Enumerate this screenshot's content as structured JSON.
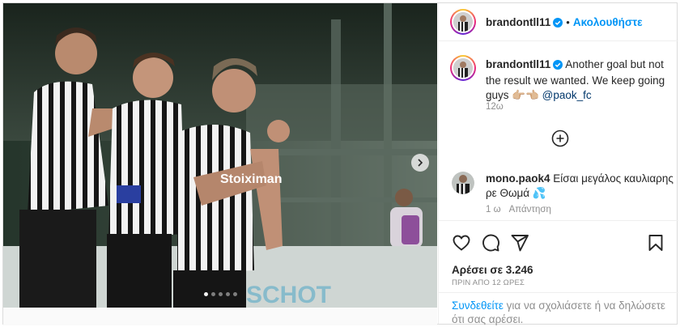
{
  "post": {
    "username": "brandontll11",
    "follow_label": "Ακολουθήστε",
    "separator": "•",
    "caption_text": "Another goal but not the result we wanted. We keep going guys 👉🏼👈🏼 ",
    "caption_mention": "@paok_fc",
    "time": "12ω",
    "likes": "Αρέσει σε 3.246",
    "posted_ago": "ΠΡΙΝ ΑΠΟ 12 ΩΡΕΣ",
    "carousel_dots": 5,
    "carousel_active": 1
  },
  "comment": {
    "username": "mono.paok4",
    "text": "Είσαι μεγάλος καυλιαρης ρε Θωμά 💦",
    "time": "1 ω",
    "reply_label": "Απάντηση"
  },
  "footer": {
    "login_link": "Συνδεθείτε",
    "login_rest": " για να σχολιάσετε ή να δηλώσετε ότι σας αρέσει."
  },
  "icons": {
    "verified": "verified-badge-icon",
    "like": "heart-icon",
    "comment": "comment-bubble-icon",
    "share": "paper-plane-icon",
    "save": "bookmark-icon",
    "load_more": "plus-circle-icon",
    "next": "chevron-right-icon"
  },
  "colors": {
    "accent": "#0095f6",
    "mention": "#00376b",
    "muted": "#8e8e8e",
    "verified": "#0095f6"
  }
}
